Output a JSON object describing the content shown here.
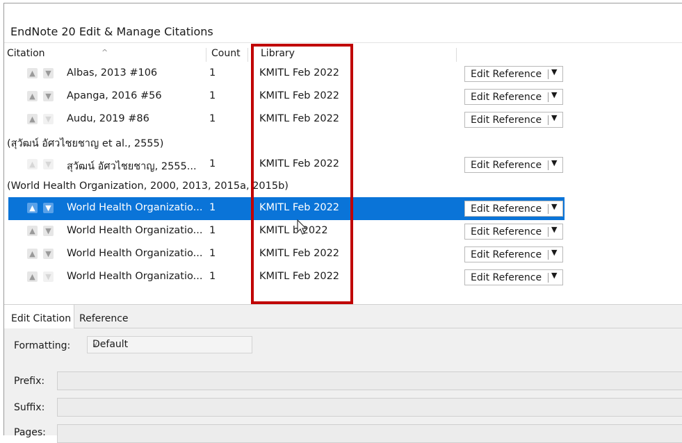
{
  "window": {
    "title": "EndNote 20 Edit & Manage Citations"
  },
  "columns": {
    "citation": "Citation",
    "count": "Count",
    "library": "Library"
  },
  "rows": [
    {
      "citation": "Albas, 2013 #106",
      "count": "1",
      "library": "KMITL Feb 2022",
      "button": "Edit Reference"
    },
    {
      "citation": "Apanga, 2016 #56",
      "count": "1",
      "library": "KMITL Feb 2022",
      "button": "Edit Reference"
    },
    {
      "citation": "Audu, 2019 #86",
      "count": "1",
      "library": "KMITL Feb 2022",
      "button": "Edit Reference"
    },
    {
      "citation": "สุวัฒน์ อัศวไชยชาญ, 2555...",
      "count": "1",
      "library": "KMITL Feb 2022",
      "button": "Edit Reference"
    },
    {
      "citation": "World Health Organizatio...",
      "count": "1",
      "library": "KMITL Feb 2022",
      "button": "Edit Reference"
    },
    {
      "citation": "World Health Organizatio...",
      "count": "1",
      "library": "KMITL  b 2022",
      "button": "Edit Reference"
    },
    {
      "citation": "World Health Organizatio...",
      "count": "1",
      "library": "KMITL Feb 2022",
      "button": "Edit Reference"
    },
    {
      "citation": "World Health Organizatio...",
      "count": "1",
      "library": "KMITL Feb 2022",
      "button": "Edit Reference"
    }
  ],
  "groups": [
    "(สุวัฒน์ อัศวไชยชาญ et al., 2555)",
    "(World Health Organization, 2000, 2013, 2015a, 2015b)"
  ],
  "tabs": {
    "edit_citation": "Edit Citation",
    "reference": "Reference"
  },
  "form": {
    "formatting_label": "Formatting:",
    "formatting_value": "Default",
    "prefix_label": "Prefix:",
    "suffix_label": "Suffix:",
    "pages_label": "Pages:"
  },
  "icons": {
    "up": "up-arrow-icon",
    "down": "down-arrow-icon",
    "dropdown": "dropdown-icon",
    "sort": "sort-ascending-icon"
  },
  "colors": {
    "selection": "#0a74d8",
    "highlight_box": "#c00000"
  }
}
